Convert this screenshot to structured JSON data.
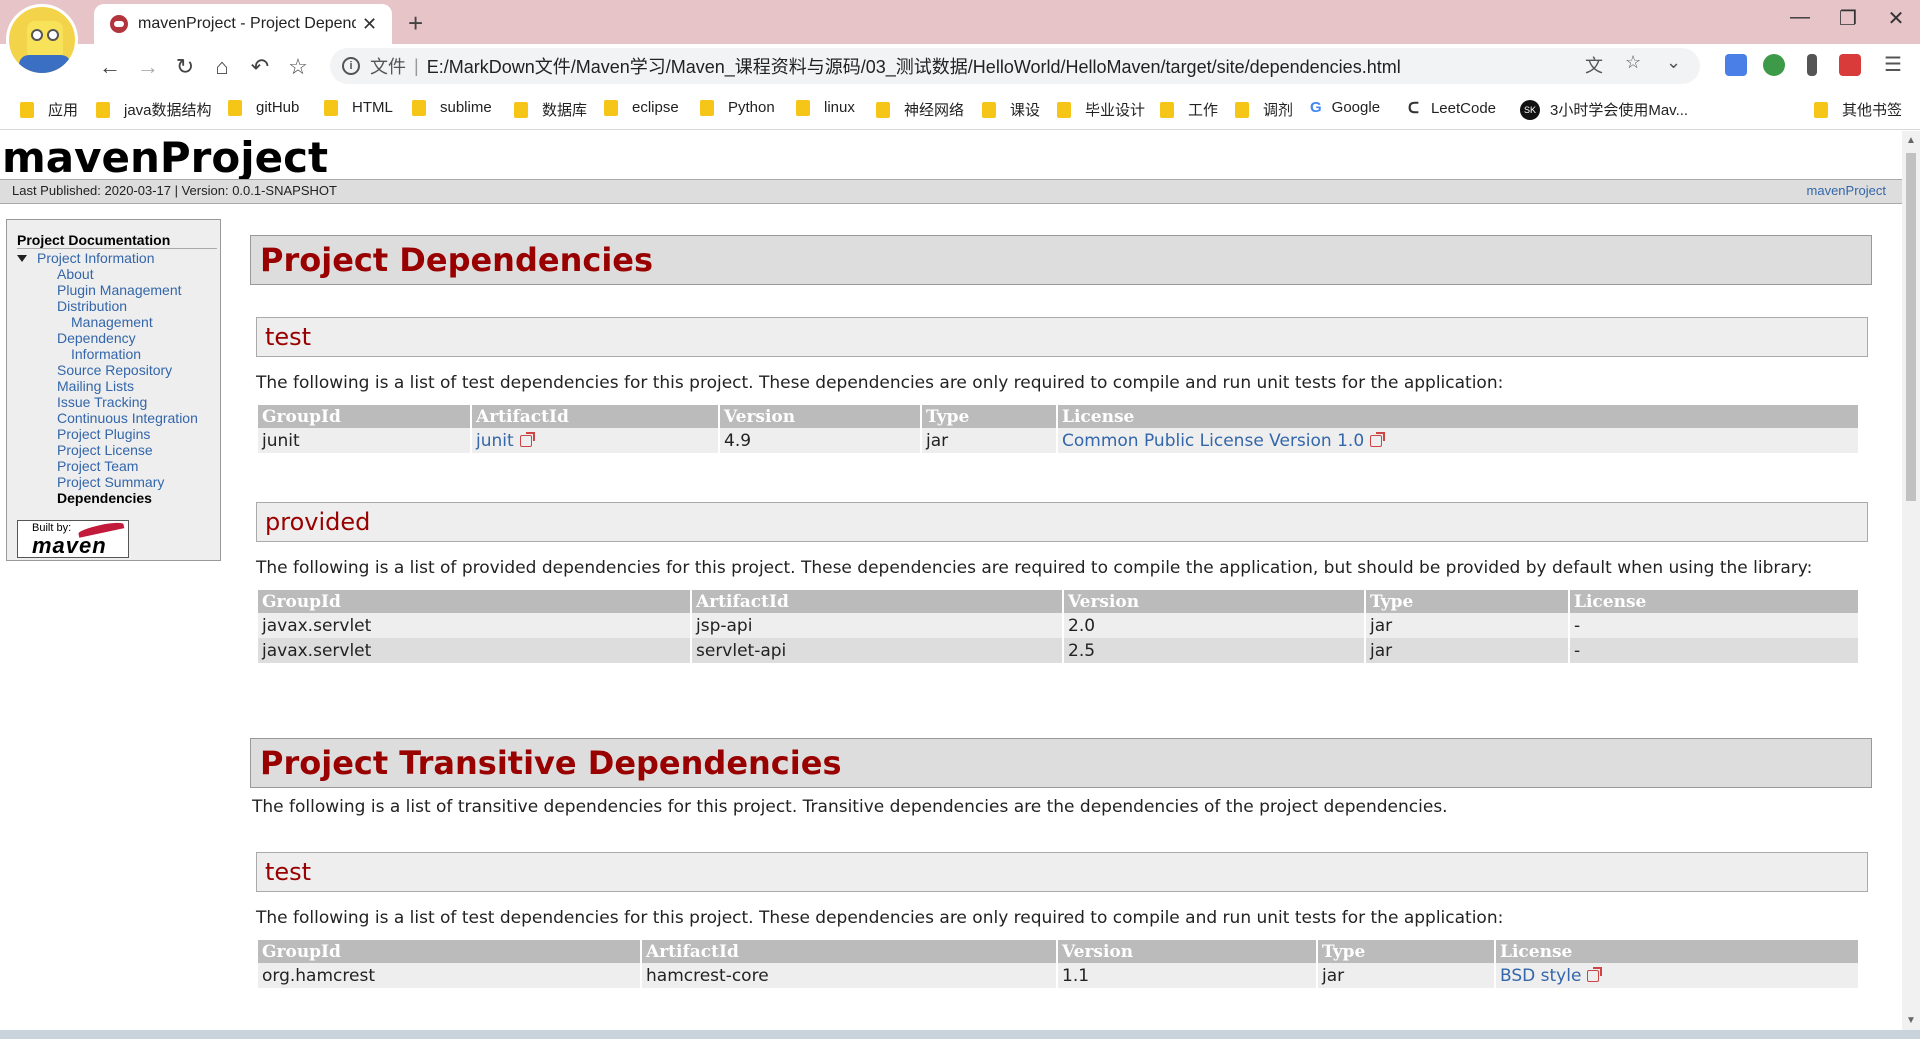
{
  "browser": {
    "tab_title": "mavenProject - Project Dependencies",
    "new_tab": "+",
    "address_scheme": "文件",
    "address_url": "E:/MarkDown文件/Maven学习/Maven_课程资料与源码/03_测试数据/HelloWorld/HelloMaven/target/site/dependencies.html",
    "bookmarks": [
      "应用",
      "java数据结构",
      "gitHub",
      "HTML",
      "sublime",
      "数据库",
      "eclipse",
      "Python",
      "linux",
      "神经网络",
      "课设",
      "毕业设计",
      "工作",
      "调剂",
      "Google",
      "LeetCode",
      "3小时学会使用Mav...",
      "其他书签"
    ]
  },
  "site": {
    "title": "mavenProject",
    "published": "Last Published: 2020-03-17  | Version: 0.0.1-SNAPSHOT",
    "project_link": "mavenProject"
  },
  "nav": {
    "heading": "Project Documentation",
    "parent": "Project Information",
    "items": [
      "About",
      "Plugin Management",
      "Distribution",
      "Management",
      "Dependency",
      "Information",
      "Source Repository",
      "Mailing Lists",
      "Issue Tracking",
      "Continuous Integration",
      "Project Plugins",
      "Project License",
      "Project Team",
      "Project Summary"
    ],
    "current": "Dependencies",
    "built_by_label": "Built by:",
    "built_by_brand": "maven"
  },
  "content": {
    "h2_deps": "Project Dependencies",
    "h3_test": "test",
    "p_test": "The following is a list of test dependencies for this project. These dependencies are only required to compile and run unit tests for the application:",
    "h3_provided": "provided",
    "p_provided": "The following is a list of provided dependencies for this project. These dependencies are required to compile the application, but should be provided by default when using the library:",
    "h2_transitive": "Project Transitive Dependencies",
    "p_transitive": "The following is a list of transitive dependencies for this project. Transitive dependencies are the dependencies of the project dependencies.",
    "h3_test2": "test",
    "p_test2": "The following is a list of test dependencies for this project. These dependencies are only required to compile and run unit tests for the application:",
    "columns": [
      "GroupId",
      "ArtifactId",
      "Version",
      "Type",
      "License"
    ],
    "test_rows": [
      {
        "group": "junit",
        "artifact": "junit",
        "version": "4.9",
        "type": "jar",
        "license": "Common Public License Version 1.0"
      }
    ],
    "provided_rows": [
      {
        "group": "javax.servlet",
        "artifact": "jsp-api",
        "version": "2.0",
        "type": "jar",
        "license": "-"
      },
      {
        "group": "javax.servlet",
        "artifact": "servlet-api",
        "version": "2.5",
        "type": "jar",
        "license": "-"
      }
    ],
    "transitive_rows": [
      {
        "group": "org.hamcrest",
        "artifact": "hamcrest-core",
        "version": "1.1",
        "type": "jar",
        "license": "BSD style"
      }
    ]
  }
}
